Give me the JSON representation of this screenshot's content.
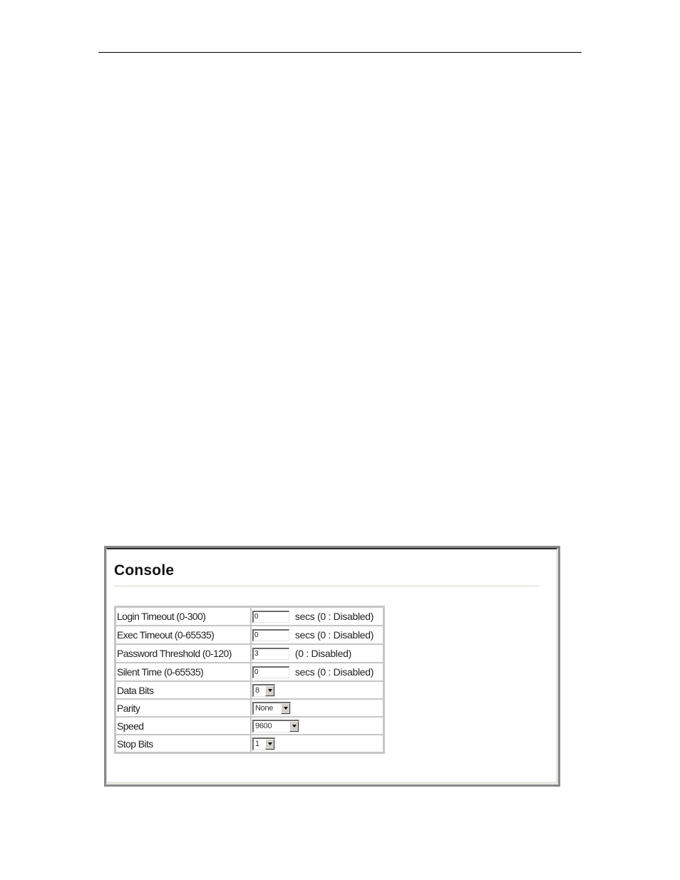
{
  "page": {
    "panel": {
      "title": "Console",
      "rows": [
        {
          "label": "Login Timeout (0-300)",
          "type": "text",
          "value": "0",
          "unit": "secs (0 : Disabled)"
        },
        {
          "label": "Exec Timeout (0-65535)",
          "type": "text",
          "value": "0",
          "unit": "secs (0 : Disabled)"
        },
        {
          "label": "Password Threshold (0-120)",
          "type": "text",
          "value": "3",
          "unit": "(0 : Disabled)"
        },
        {
          "label": "Silent Time (0-65535)",
          "type": "text",
          "value": "0",
          "unit": "secs (0 : Disabled)"
        },
        {
          "label": "Data Bits",
          "type": "select",
          "value": "8"
        },
        {
          "label": "Parity",
          "type": "select",
          "value": "None"
        },
        {
          "label": "Speed",
          "type": "select",
          "value": "9600"
        },
        {
          "label": "Stop Bits",
          "type": "select",
          "value": "1"
        }
      ]
    },
    "icons": {
      "dropdown": "chevron-down-icon"
    },
    "colors": {
      "frame_border": "#8a8a8a",
      "table_border": "#c6c6c6",
      "title_rule": "#d8d4c8",
      "dropdown_button": "#d4d0c8"
    }
  }
}
